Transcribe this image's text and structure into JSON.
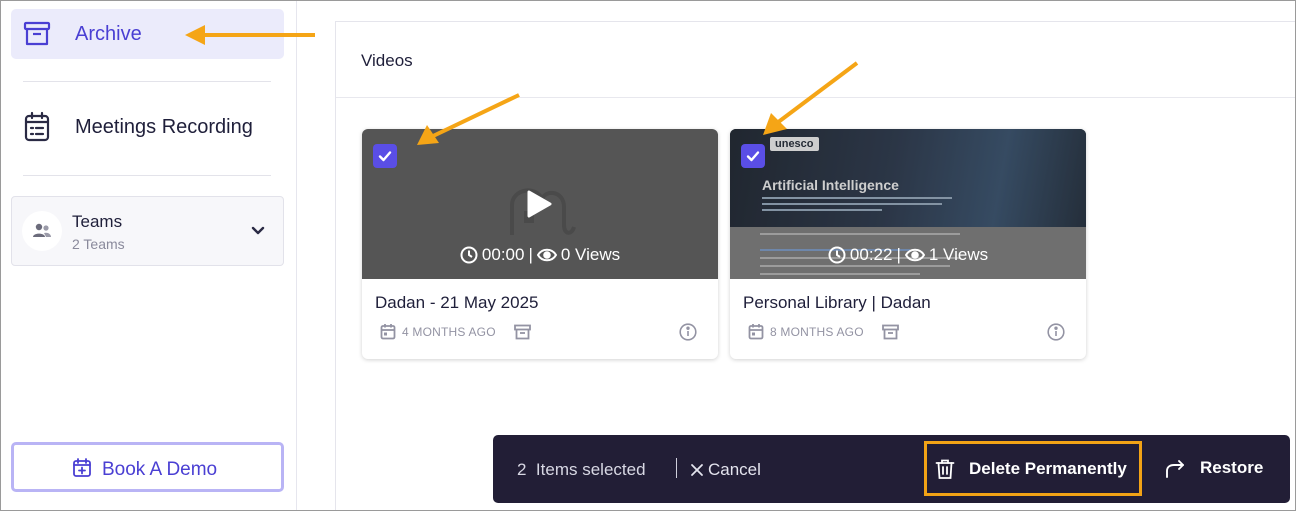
{
  "sidebar": {
    "archive_label": "Archive",
    "meetings_label": "Meetings Recording",
    "teams": {
      "title": "Teams",
      "subtitle": "2 Teams"
    },
    "book_demo_label": "Book A Demo"
  },
  "main": {
    "section_title": "Videos",
    "videos": [
      {
        "title": "Dadan - 21 May 2025",
        "duration": "00:00",
        "views": "0 Views",
        "age": "4 MONTHS AGO",
        "selected": true
      },
      {
        "title": "Personal Library | Dadan",
        "duration": "00:22",
        "views": "1 Views",
        "age": "8 MONTHS AGO",
        "selected": true,
        "thumbnail": {
          "brand": "unesco",
          "headline": "Artificial Intelligence"
        }
      }
    ]
  },
  "action_bar": {
    "count": "2",
    "selected_text": "Items selected",
    "cancel_label": "Cancel",
    "delete_label": "Delete Permanently",
    "restore_label": "Restore"
  },
  "colors": {
    "accent": "#4a3fd3",
    "checkbox": "#5a4ee6",
    "action_bar_bg": "#221e36",
    "highlight": "#f2a316"
  },
  "icons": {
    "archive": "archive-box-icon",
    "meetings": "calendar-list-icon",
    "teams": "users-icon",
    "book": "calendar-plus-icon",
    "duration": "clock-icon",
    "views": "eye-icon",
    "date": "calendar-icon",
    "archive_small": "archive-box-icon",
    "info": "info-circle-icon",
    "delete": "trash-icon",
    "restore": "redo-arrow-icon",
    "cancel": "close-icon"
  }
}
